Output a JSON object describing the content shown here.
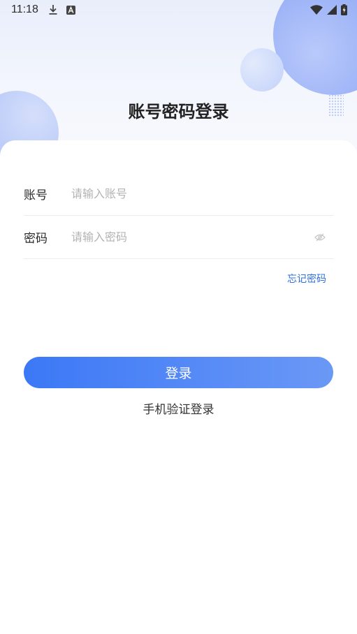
{
  "status_bar": {
    "time": "11:18",
    "icons": [
      "download-icon",
      "font-a-icon",
      "wifi-icon",
      "signal-icon",
      "battery-charging-icon"
    ]
  },
  "page": {
    "title": "账号密码登录"
  },
  "form": {
    "account_label": "账号",
    "account_placeholder": "请输入账号",
    "account_value": "",
    "password_label": "密码",
    "password_placeholder": "请输入密码",
    "password_value": "",
    "forgot_password": "忘记密码",
    "login_button": "登录",
    "sms_login": "手机验证登录"
  },
  "colors": {
    "accent": "#3c78f6",
    "accent_light": "#6a98f6",
    "link": "#2f6fe0"
  }
}
